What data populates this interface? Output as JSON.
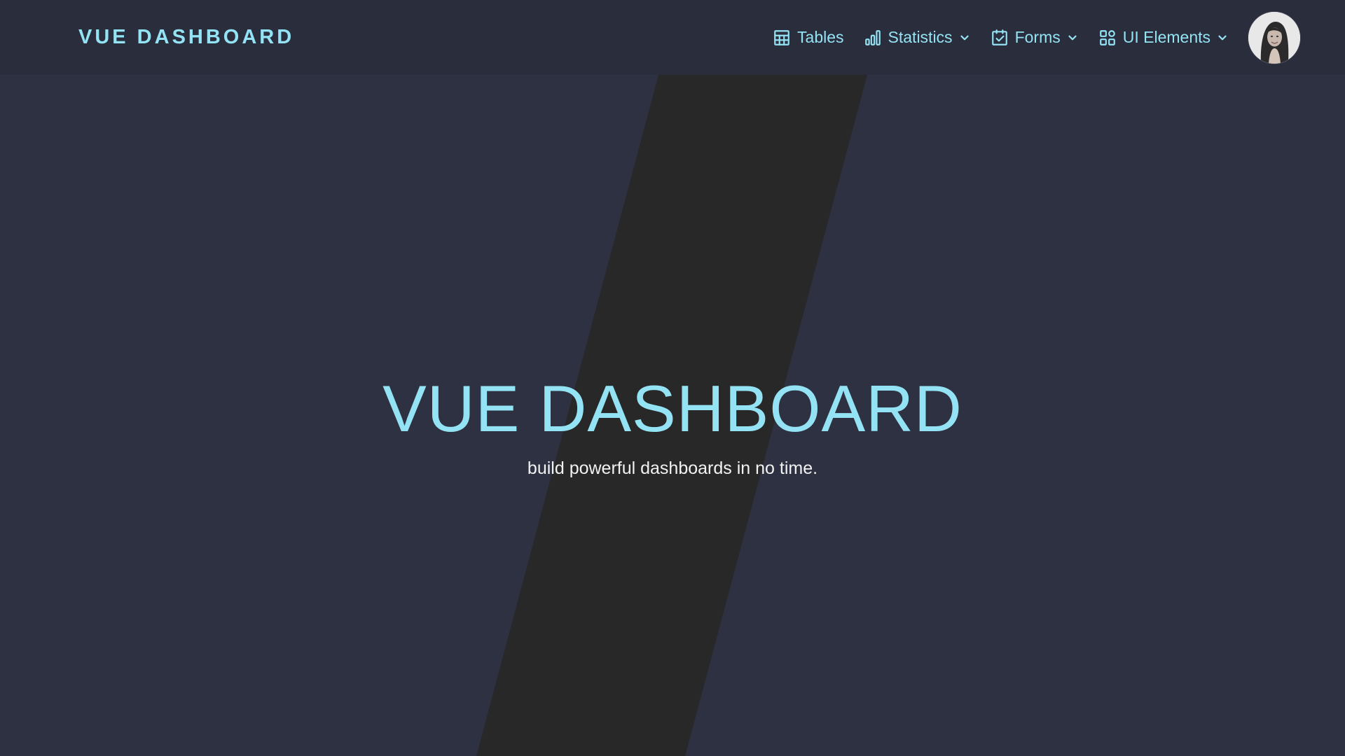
{
  "navbar": {
    "brand": "VUE DASHBOARD",
    "items": [
      {
        "label": "Tables",
        "icon": "table-icon",
        "dropdown": false
      },
      {
        "label": "Statistics",
        "icon": "bar-chart-icon",
        "dropdown": true
      },
      {
        "label": "Forms",
        "icon": "calendar-check-icon",
        "dropdown": true
      },
      {
        "label": "UI Elements",
        "icon": "grid-apps-icon",
        "dropdown": true
      }
    ],
    "avatar_icon": "user-avatar"
  },
  "hero": {
    "title": "VUE DASHBOARD",
    "subtitle": "build powerful dashboards in no time."
  },
  "colors": {
    "background": "#2e3141",
    "navbar": "#2a2d3b",
    "stripe": "#282828",
    "accent": "#94e3f5",
    "subtitle_text": "#f2f2f2"
  }
}
